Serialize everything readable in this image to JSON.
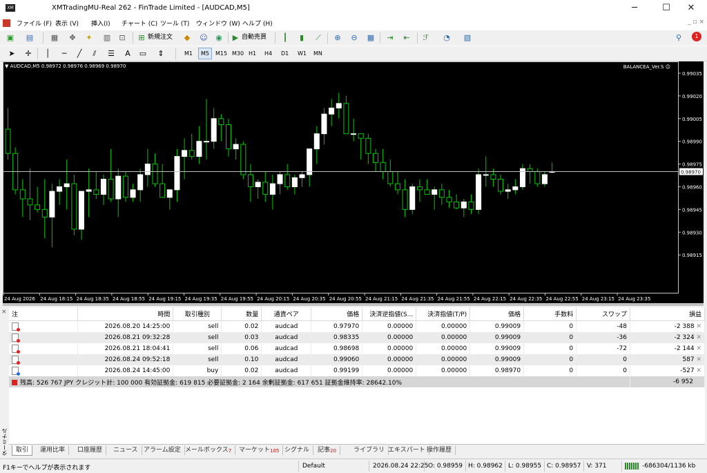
{
  "window": {
    "app_icon": "XM",
    "title": "XMTradingMU-Real 262 - FinTrade Limited - [AUDCAD,M5]",
    "minimize": "─",
    "maximize": "☐",
    "close": "✕"
  },
  "menu": [
    "ファイル (F)",
    "表示 (V)",
    "挿入(I)",
    "チャート (C)",
    "ツール (T)",
    "ウィンドウ (W)",
    "ヘルプ (H)"
  ],
  "mdi_controls": "_ ▫ ×",
  "toolbar": {
    "new_order": "新規注文",
    "auto_trading": "自動売買",
    "notification_count": "1"
  },
  "timeframes": [
    "M1",
    "M5",
    "M15",
    "M30",
    "H1",
    "H4",
    "D1",
    "W1",
    "MN"
  ],
  "selected_timeframe": "M5",
  "chart": {
    "header": "▼ AUDCAD,M5  0.98972 0.98976 0.98969 0.98970",
    "ea_label": "BALANCEA_Ver.S ☺",
    "current_price_label": "0.98970"
  },
  "chart_data": {
    "type": "candlestick",
    "symbol": "AUDCAD",
    "timeframe": "M5",
    "ylim": [
      0.9889,
      0.9904
    ],
    "y_ticks": [
      "0.99035",
      "0.99020",
      "0.99005",
      "0.98990",
      "0.98975",
      "0.98960",
      "0.98945",
      "0.98930",
      "0.98915"
    ],
    "y_tick_values": [
      0.99035,
      0.9902,
      0.99005,
      0.9899,
      0.98975,
      0.9896,
      0.98945,
      0.9893,
      0.98915
    ],
    "x_ticks": [
      "24 Aug 2026",
      "24 Aug 18:15",
      "24 Aug 18:35",
      "24 Aug 18:55",
      "24 Aug 19:15",
      "24 Aug 19:35",
      "24 Aug 19:55",
      "24 Aug 20:15",
      "24 Aug 20:35",
      "24 Aug 20:55",
      "24 Aug 21:15",
      "24 Aug 21:35",
      "24 Aug 21:55",
      "24 Aug 22:15",
      "24 Aug 22:35",
      "24 Aug 22:55",
      "24 Aug 23:15",
      "24 Aug 23:35"
    ],
    "current_price": 0.9897,
    "bull_color": "#ffffff",
    "bear_color": "#000000",
    "wick_color": "#00c800",
    "candles": [
      [
        0.98998,
        0.99012,
        0.98978,
        0.98982
      ],
      [
        0.98982,
        0.98986,
        0.98955,
        0.98958
      ],
      [
        0.98958,
        0.98965,
        0.9894,
        0.98952
      ],
      [
        0.98952,
        0.98972,
        0.98938,
        0.98948
      ],
      [
        0.98948,
        0.9896,
        0.98943,
        0.98945
      ],
      [
        0.98945,
        0.98965,
        0.98926,
        0.9894
      ],
      [
        0.9894,
        0.98962,
        0.9892,
        0.98957
      ],
      [
        0.98957,
        0.98965,
        0.98948,
        0.9896
      ],
      [
        0.9896,
        0.98978,
        0.98945,
        0.98962
      ],
      [
        0.98962,
        0.98968,
        0.98928,
        0.98932
      ],
      [
        0.98932,
        0.98955,
        0.98925,
        0.98957
      ],
      [
        0.98957,
        0.98972,
        0.9894,
        0.98958
      ],
      [
        0.98958,
        0.9897,
        0.98952,
        0.98955
      ],
      [
        0.98955,
        0.98968,
        0.98948,
        0.98965
      ],
      [
        0.98965,
        0.98985,
        0.9895,
        0.98952
      ],
      [
        0.98952,
        0.98972,
        0.9894,
        0.98967
      ],
      [
        0.98967,
        0.9897,
        0.9895,
        0.98953
      ],
      [
        0.98953,
        0.98962,
        0.9895,
        0.98958
      ],
      [
        0.98958,
        0.98972,
        0.9895,
        0.98968
      ],
      [
        0.98968,
        0.98985,
        0.9896,
        0.98975
      ],
      [
        0.98975,
        0.98982,
        0.9896,
        0.98962
      ],
      [
        0.98962,
        0.98975,
        0.98955,
        0.98953
      ],
      [
        0.98953,
        0.98958,
        0.98945,
        0.98958
      ],
      [
        0.98958,
        0.98985,
        0.9895,
        0.9898
      ],
      [
        0.9898,
        0.98992,
        0.98965,
        0.98984
      ],
      [
        0.98984,
        0.98995,
        0.98978,
        0.9898
      ],
      [
        0.9898,
        0.99,
        0.98975,
        0.9899
      ],
      [
        0.9899,
        0.99018,
        0.98978,
        0.9899
      ],
      [
        0.9899,
        0.99012,
        0.98985,
        0.99005
      ],
      [
        0.99005,
        0.99008,
        0.9899,
        0.99001
      ],
      [
        0.99001,
        0.99005,
        0.9898,
        0.98985
      ],
      [
        0.98985,
        0.98992,
        0.98978,
        0.98988
      ],
      [
        0.98988,
        0.9899,
        0.98965,
        0.98968
      ],
      [
        0.98968,
        0.98975,
        0.9895,
        0.9896
      ],
      [
        0.9896,
        0.98965,
        0.98952,
        0.98963
      ],
      [
        0.98963,
        0.9897,
        0.9895,
        0.98955
      ],
      [
        0.98955,
        0.98968,
        0.98945,
        0.98962
      ],
      [
        0.98962,
        0.9897,
        0.98955,
        0.98968
      ],
      [
        0.98968,
        0.98975,
        0.98958,
        0.9896
      ],
      [
        0.9896,
        0.98968,
        0.98955,
        0.98966
      ],
      [
        0.98966,
        0.9897,
        0.9896,
        0.98968
      ],
      [
        0.98968,
        0.98985,
        0.9896,
        0.98985
      ],
      [
        0.98985,
        0.99,
        0.98975,
        0.98995
      ],
      [
        0.98995,
        0.99012,
        0.98988,
        0.99008
      ],
      [
        0.99008,
        0.99018,
        0.99,
        0.99012
      ],
      [
        0.99012,
        0.99022,
        0.99005,
        0.99015
      ],
      [
        0.99015,
        0.9902,
        0.98995,
        0.98995
      ],
      [
        0.98995,
        0.99005,
        0.9899,
        0.98995
      ],
      [
        0.98995,
        0.98995,
        0.98978,
        0.98992
      ],
      [
        0.98992,
        0.98995,
        0.98975,
        0.98982
      ],
      [
        0.98982,
        0.98985,
        0.9897,
        0.98976
      ],
      [
        0.98976,
        0.98985,
        0.98965,
        0.9897
      ],
      [
        0.9897,
        0.98978,
        0.9896,
        0.98962
      ],
      [
        0.98962,
        0.9897,
        0.98955,
        0.98958
      ],
      [
        0.98958,
        0.98965,
        0.9894,
        0.98945
      ],
      [
        0.98945,
        0.98962,
        0.98942,
        0.9896
      ],
      [
        0.9896,
        0.98965,
        0.9895,
        0.98958
      ],
      [
        0.98958,
        0.98965,
        0.98955,
        0.98955
      ],
      [
        0.98955,
        0.9896,
        0.98945,
        0.98958
      ],
      [
        0.98958,
        0.98962,
        0.98948,
        0.98953
      ],
      [
        0.98953,
        0.98958,
        0.98946,
        0.9895
      ],
      [
        0.9895,
        0.98955,
        0.98945,
        0.98946
      ],
      [
        0.98946,
        0.98952,
        0.9894,
        0.9895
      ],
      [
        0.9895,
        0.98955,
        0.98942,
        0.98945
      ],
      [
        0.98945,
        0.98972,
        0.98942,
        0.98968
      ],
      [
        0.98968,
        0.9898,
        0.9896,
        0.98968
      ],
      [
        0.98968,
        0.98972,
        0.9896,
        0.98965
      ],
      [
        0.98965,
        0.98968,
        0.98955,
        0.98957
      ],
      [
        0.98957,
        0.98962,
        0.98952,
        0.98958
      ],
      [
        0.98958,
        0.98965,
        0.98955,
        0.9896
      ],
      [
        0.9896,
        0.98975,
        0.98958,
        0.98972
      ],
      [
        0.98972,
        0.98975,
        0.98962,
        0.9897
      ],
      [
        0.9897,
        0.98972,
        0.9896,
        0.98962
      ],
      [
        0.98962,
        0.9897,
        0.9896,
        0.98968
      ],
      [
        0.9897,
        0.98976,
        0.98969,
        0.9897
      ]
    ]
  },
  "terminal": {
    "side_label": "ターミナル",
    "close_icon": "×",
    "columns": [
      "注",
      "時間",
      "取引種別",
      "数量",
      "通貨ペア",
      "価格",
      "決済逆指値(S...",
      "決済指値(T/P)",
      "価格",
      "手数料",
      "スワップ",
      "損益"
    ],
    "rows": [
      {
        "time": "2026.08.20 14:25:00",
        "type": "sell",
        "volume": "0.02",
        "symbol": "audcad",
        "price": "0.97970",
        "sl": "0.00000",
        "tp": "0.00000",
        "cur_price": "0.99009",
        "commission": "0",
        "swap": "-48",
        "profit": "-2 388"
      },
      {
        "time": "2026.08.21 09:32:28",
        "type": "sell",
        "volume": "0.03",
        "symbol": "audcad",
        "price": "0.98335",
        "sl": "0.00000",
        "tp": "0.00000",
        "cur_price": "0.99009",
        "commission": "0",
        "swap": "-36",
        "profit": "-2 324"
      },
      {
        "time": "2026.08.21 18:04:41",
        "type": "sell",
        "volume": "0.06",
        "symbol": "audcad",
        "price": "0.98698",
        "sl": "0.00000",
        "tp": "0.00000",
        "cur_price": "0.99009",
        "commission": "0",
        "swap": "-72",
        "profit": "-2 144"
      },
      {
        "time": "2026.08.24 09:52:18",
        "type": "sell",
        "volume": "0.10",
        "symbol": "audcad",
        "price": "0.99060",
        "sl": "0.00000",
        "tp": "0.00000",
        "cur_price": "0.99009",
        "commission": "0",
        "swap": "0",
        "profit": "587"
      },
      {
        "time": "2026.08.24 14:45:00",
        "type": "buy",
        "volume": "0.02",
        "symbol": "audcad",
        "price": "0.99199",
        "sl": "0.00000",
        "tp": "0.00000",
        "cur_price": "0.98970",
        "commission": "0",
        "swap": "0",
        "profit": "-527"
      }
    ],
    "summary": "残高: 526 767 JPY  クレジット計: 100 000  有効証拠金: 619 815  必要証拠金: 2 164  余剰証拠金: 617 651  証拠金維持率: 28642.10%",
    "summary_total": "-6 952"
  },
  "tabs": [
    {
      "label": "取引",
      "badge": ""
    },
    {
      "label": "運用比率",
      "badge": ""
    },
    {
      "label": "口座履歴",
      "badge": ""
    },
    {
      "label": "ニュース",
      "badge": ""
    },
    {
      "label": "アラーム設定",
      "badge": ""
    },
    {
      "label": "メールボックス",
      "badge": "7"
    },
    {
      "label": "マーケット",
      "badge": "105"
    },
    {
      "label": "シグナル",
      "badge": ""
    },
    {
      "label": "記事",
      "badge": "20"
    },
    {
      "label": "ライブラリ",
      "badge": ""
    },
    {
      "label": "エキスパート",
      "badge": ""
    },
    {
      "label": "操作履歴",
      "badge": ""
    }
  ],
  "status": {
    "help": "F1キーでヘルプが表示されます",
    "profile": "Default",
    "datetime": "2026.08.24 22:25",
    "open": "O: 0.98959",
    "high": "H: 0.98962",
    "low": "L: 0.98955",
    "close": "C: 0.98957",
    "volume": "V: 371",
    "traffic": "-686304/1136 kb"
  }
}
